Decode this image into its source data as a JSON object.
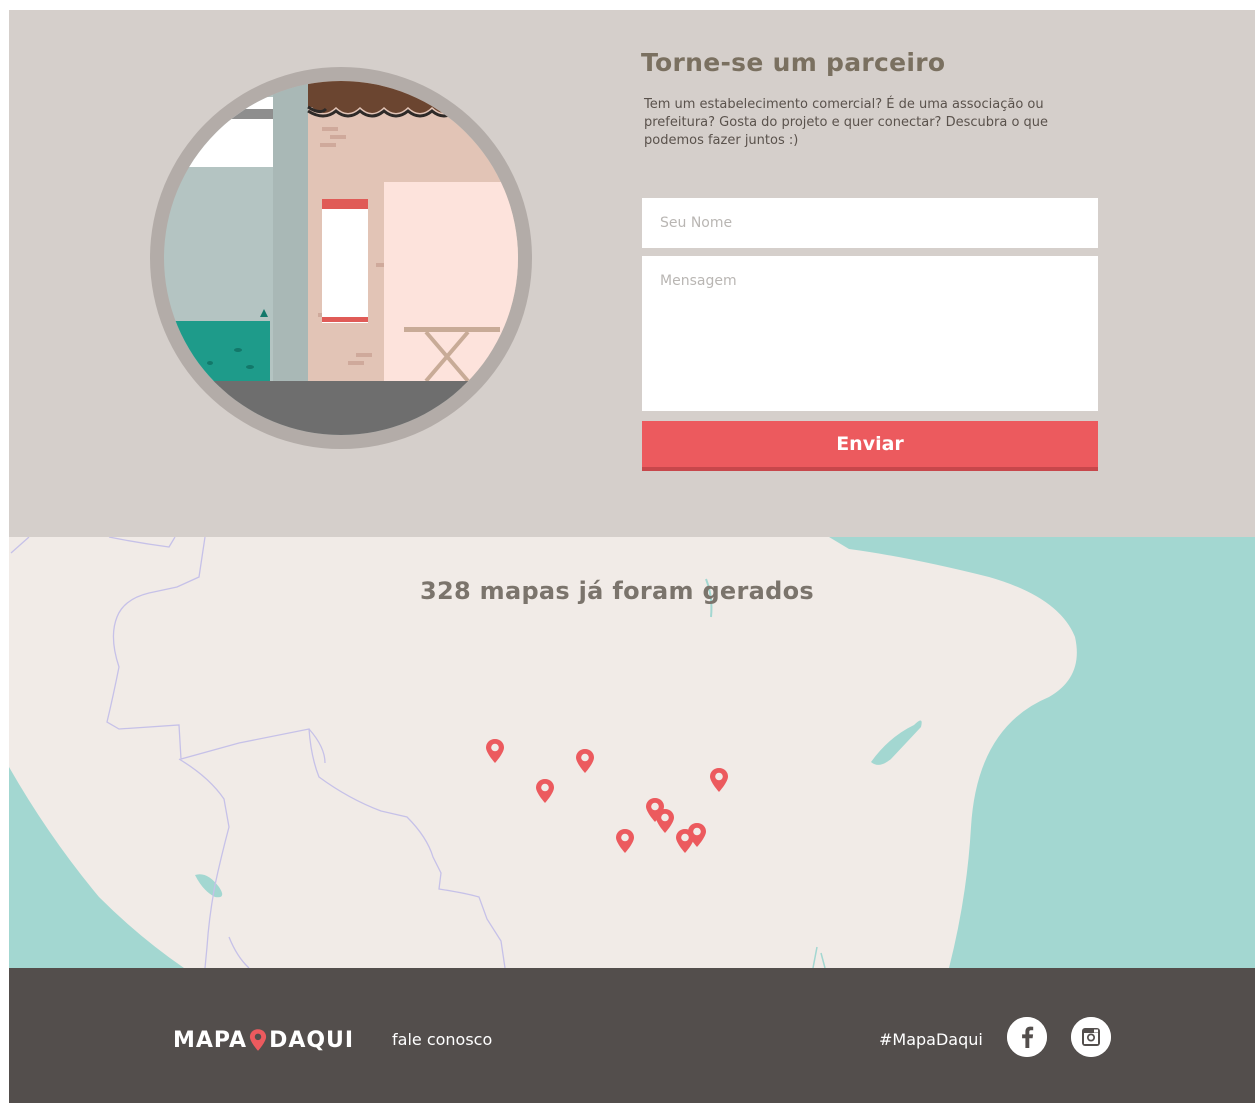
{
  "partner": {
    "title": "Torne-se um parceiro",
    "description": "Tem um estabelecimento comercial? É de uma associação ou prefeitura? Gosta do projeto e quer conectar? Descubra o que podemos fazer juntos :)",
    "name_placeholder": "Seu Nome",
    "message_placeholder": "Mensagem",
    "submit_label": "Enviar"
  },
  "map": {
    "counter_text": "328 mapas já foram gerados",
    "pin_count": 9
  },
  "footer": {
    "logo_left": "MAPA",
    "logo_right": "DAQUI",
    "contact_link": "fale conosco",
    "hashtag": "#MapaDaqui",
    "social_icons": [
      "facebook-icon",
      "instagram-icon"
    ]
  },
  "colors": {
    "accent": "#ec5a5e",
    "partner_bg": "#d5cfcb",
    "map_land": "#f1ebe7",
    "map_water": "#a3d7d1",
    "footer_bg": "#534e4c",
    "title_text": "#7a7060"
  }
}
